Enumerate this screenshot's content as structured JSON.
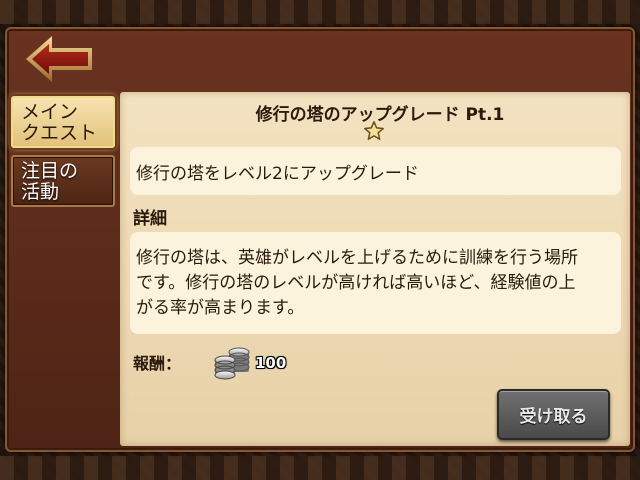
{
  "nav": {
    "back_icon": "back-arrow-icon",
    "tabs": [
      {
        "label_line1": "メイン",
        "label_line2": "クエスト",
        "selected": true
      },
      {
        "label_line1": "注目の",
        "label_line2": "活動",
        "selected": false
      }
    ]
  },
  "quest": {
    "title": "修行の塔のアップグレード Pt.1",
    "star_icon": "star-icon",
    "objective": "修行の塔をレベル2にアップグレード",
    "details_label": "詳細",
    "details_lines": [
      "修行の塔は、英雄がレベルを上げるために訓練を行う場所",
      "です。修行の塔のレベルが高ければ高いほど、経験値の上",
      "がる率が高まります。"
    ],
    "reward_label": "報酬：",
    "reward_icon": "silver-coins-icon",
    "reward_amount": "100",
    "receive_button": "受け取る"
  },
  "colors": {
    "panel": "#5a2a1a",
    "parchment": "#efdcb5",
    "text_box": "#fbf3dc",
    "tab_selected": "#eccb86",
    "button_disabled": "#5c5c5c"
  }
}
